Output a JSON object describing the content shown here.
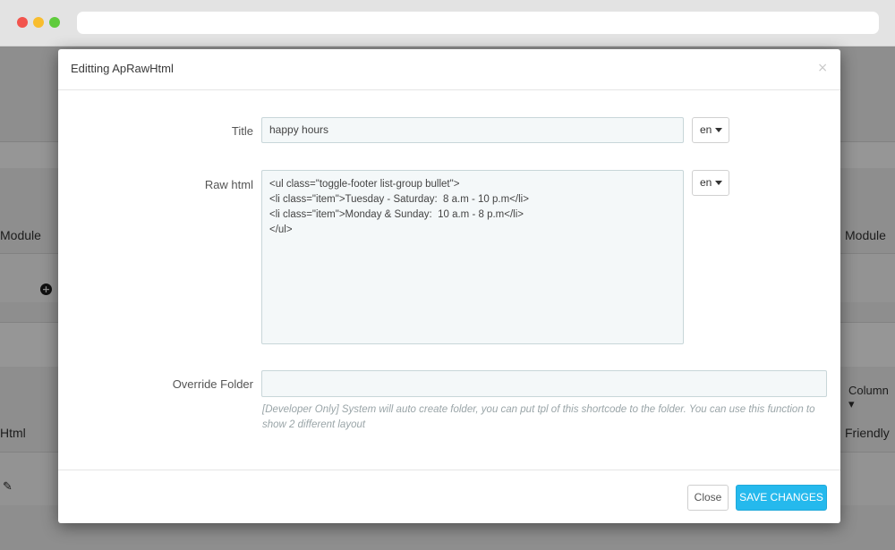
{
  "background": {
    "left_module": "Module",
    "right_module": "Module",
    "right_column": "Column ▾",
    "left_html": "Html",
    "right_friendly": "Friendly",
    "plus_icon": "plus-circle-icon",
    "pencil_icon": "pencil-icon"
  },
  "modal": {
    "title": "Editting ApRawHtml",
    "close_symbol": "×",
    "fields": {
      "title_label": "Title",
      "title_value": "happy hours",
      "title_lang": "en",
      "raw_html_label": "Raw html",
      "raw_html_value": "<ul class=\"toggle-footer list-group bullet\">\n<li class=\"item\">Tuesday - Saturday:  8 a.m - 10 p.m</li>\n<li class=\"item\">Monday & Sunday:  10 a.m - 8 p.m</li>\n</ul>",
      "raw_html_lang": "en",
      "override_label": "Override Folder",
      "override_value": "",
      "override_help": "[Developer Only] System will auto create folder, you can put tpl of this shortcode to the folder. You can use this function to show 2 different layout"
    },
    "buttons": {
      "close": "Close",
      "save": "SAVE CHANGES"
    }
  },
  "colors": {
    "accent": "#25b9ed",
    "overlay": "#8e8e8e"
  }
}
